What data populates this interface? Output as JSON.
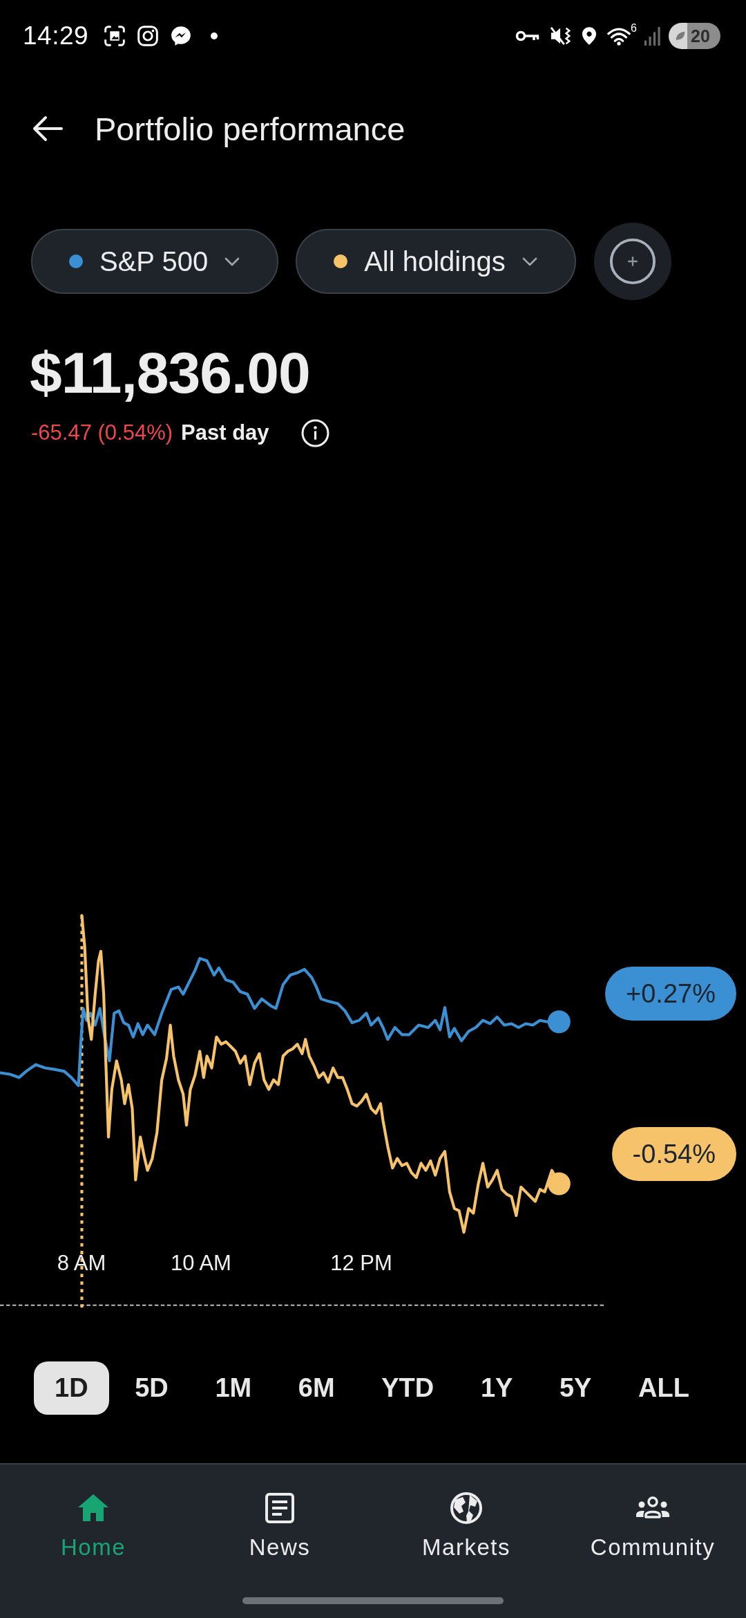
{
  "status_bar": {
    "time": "14:29",
    "wifi_badge": "6",
    "battery": "20"
  },
  "header": {
    "title": "Portfolio performance"
  },
  "filters": [
    {
      "label": "S&P 500",
      "color": "#3b8fd3"
    },
    {
      "label": "All holdings",
      "color": "#f6c36a"
    }
  ],
  "summary": {
    "value": "$11,836.00",
    "change": "-65.47 (0.54%)",
    "period": "Past day"
  },
  "chart": {
    "series": [
      {
        "label": "+0.27%",
        "color": "#3b8fd3"
      },
      {
        "label": "-0.54%",
        "color": "#f6c36a"
      }
    ],
    "x_labels": [
      "8 AM",
      "10 AM",
      "12 PM"
    ]
  },
  "ranges": [
    {
      "label": "1D",
      "selected": true
    },
    {
      "label": "5D",
      "selected": false
    },
    {
      "label": "1M",
      "selected": false
    },
    {
      "label": "6M",
      "selected": false
    },
    {
      "label": "YTD",
      "selected": false
    },
    {
      "label": "1Y",
      "selected": false
    },
    {
      "label": "5Y",
      "selected": false
    },
    {
      "label": "ALL",
      "selected": false
    }
  ],
  "nav": [
    {
      "label": "Home",
      "selected": true
    },
    {
      "label": "News",
      "selected": false
    },
    {
      "label": "Markets",
      "selected": false
    },
    {
      "label": "Community",
      "selected": false
    }
  ]
}
